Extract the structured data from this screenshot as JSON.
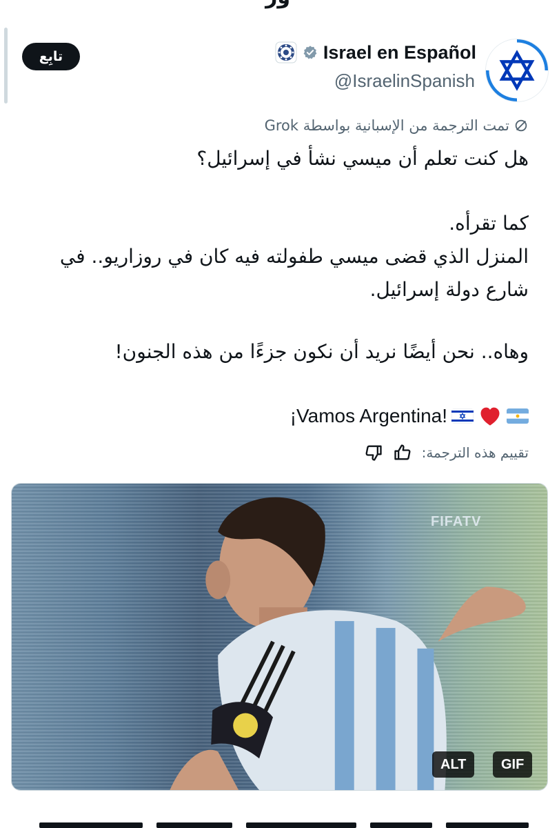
{
  "top_cut": {
    "text": "ور"
  },
  "header": {
    "follow_label": "تابِع",
    "display_name": "Israel en Español",
    "handle": "@IsraelinSpanish",
    "avatar_icon": "star-of-david-icon",
    "verified_icon": "verified-badge-icon",
    "affiliate_icon": "government-seal-icon",
    "verified_color": "#829aab",
    "flag_blue": "#0038b8"
  },
  "tweet": {
    "translated_note": "تمت الترجمة من الإسبانية بواسطة Grok",
    "line1": "هل كنت تعلم أن ميسي نشأ في إسرائيل؟",
    "line2": "كما تقرأه.",
    "line3": "المنزل الذي قضى ميسي طفولته فيه كان في روزاريو.. في",
    "line4": "شارع دولة إسرائيل.",
    "line5": "وهاه.. نحن أيضًا نريد أن نكون جزءًا من هذه الجنون!",
    "vamos": "¡Vamos Argentina!",
    "emojis": [
      "israel-flag-icon",
      "red-heart-icon",
      "argentina-flag-icon"
    ],
    "rate_translation": "تقييم هذه الترجمة:"
  },
  "media": {
    "watermark": "FIFATV",
    "alt_label": "ALT",
    "gif_label": "GIF"
  }
}
